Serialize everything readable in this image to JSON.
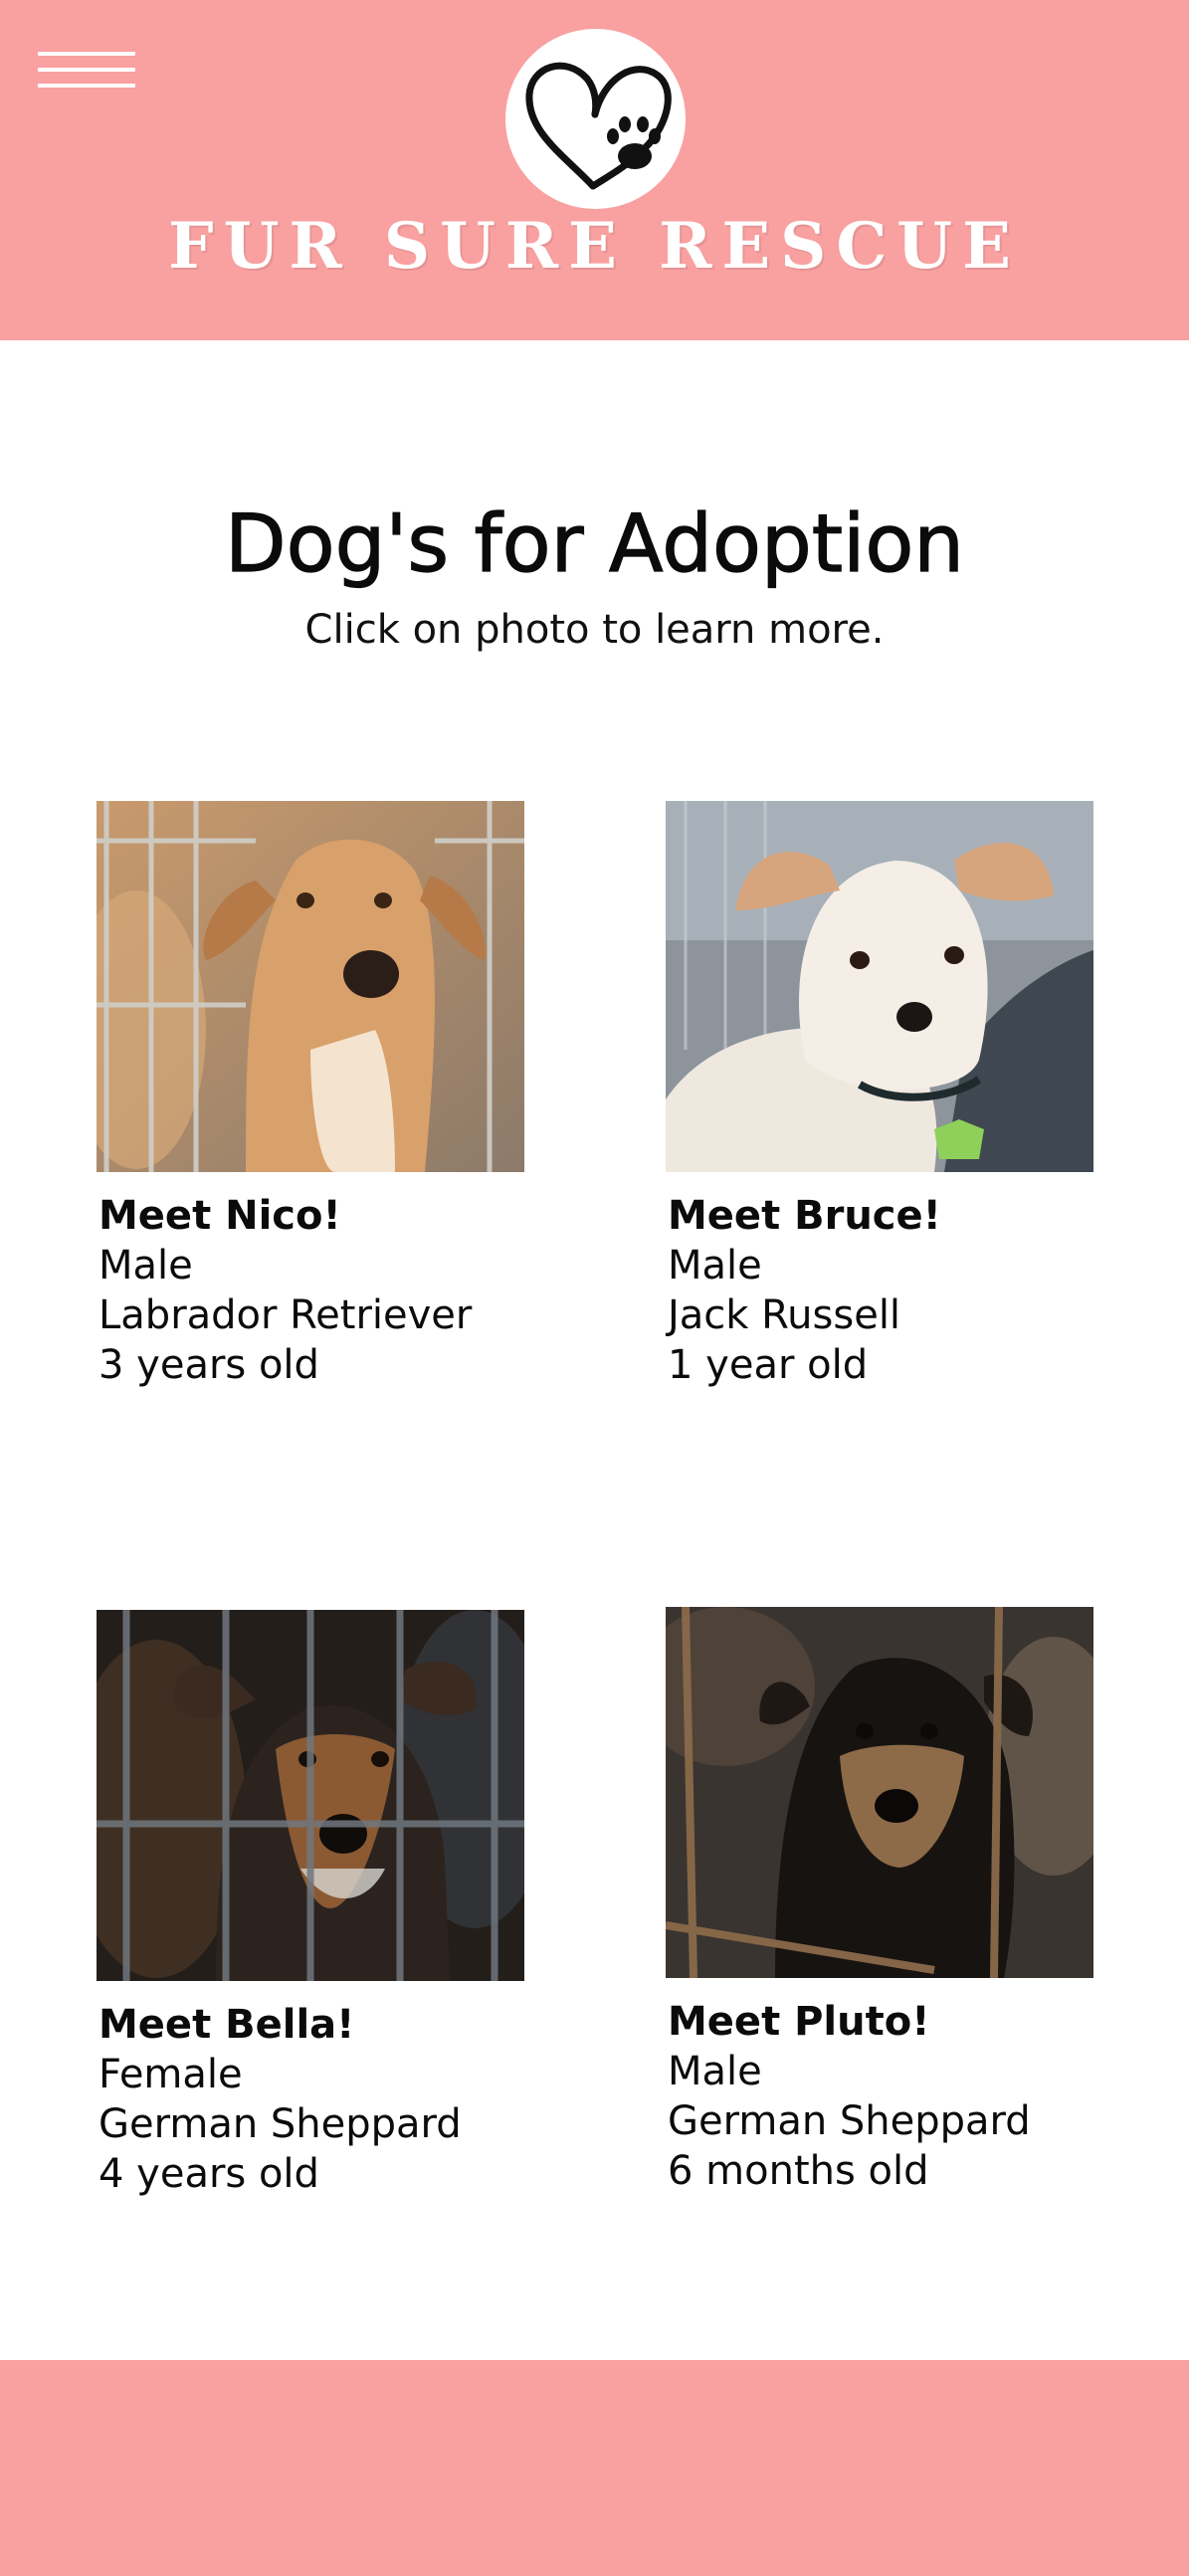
{
  "header": {
    "brand": "FUR SURE RESCUE",
    "menu_icon": "hamburger-menu-icon",
    "logo_icon": "heart-paw-logo-icon",
    "background_color": "#f9a0a0"
  },
  "main": {
    "title": "Dog's for Adoption",
    "subtitle": "Click on photo to learn more."
  },
  "dogs": [
    {
      "name": "Meet Nico!",
      "sex": "Male",
      "breed": "Labrador Retriever",
      "age": "3 years old"
    },
    {
      "name": "Meet Bruce!",
      "sex": "Male",
      "breed": "Jack Russell",
      "age": "1 year old"
    },
    {
      "name": "Meet Bella!",
      "sex": "Female",
      "breed": "German Sheppard",
      "age": "4 years old"
    },
    {
      "name": "Meet Pluto!",
      "sex": "Male",
      "breed": "German Sheppard",
      "age": "6 months old"
    }
  ]
}
